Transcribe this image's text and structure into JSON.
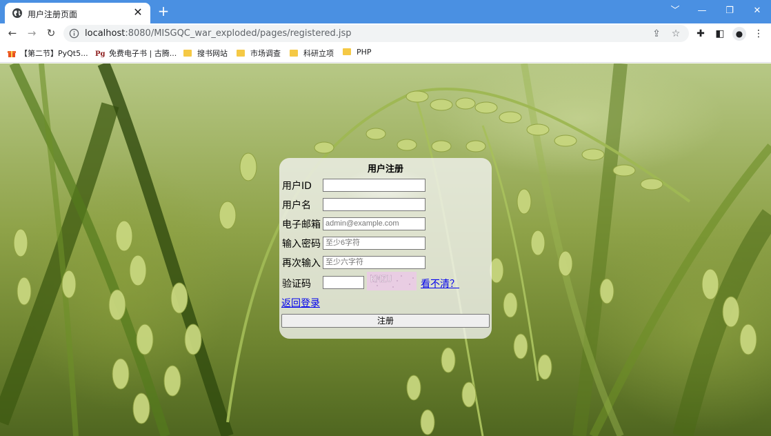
{
  "browser": {
    "tab_title": "用户注册页面",
    "tab_close": "✕",
    "new_tab": "+",
    "url_host": "localhost",
    "url_path": ":8080/MISGQC_war_exploded/pages/registered.jsp",
    "window_controls": [
      "﹀",
      "—",
      "❐",
      "✕"
    ]
  },
  "bookmarks": [
    {
      "label": "【第二节】PyQt5...",
      "icon": "gift-icon"
    },
    {
      "label": "免费电子书 | 古腾...",
      "icon": "pg-icon"
    },
    {
      "label": "搜书网站",
      "icon": "folder-icon"
    },
    {
      "label": "市场调查",
      "icon": "folder-icon"
    },
    {
      "label": "科研立项",
      "icon": "folder-icon"
    },
    {
      "label": "PHP",
      "icon": "folder-icon"
    }
  ],
  "form": {
    "title": "用户注册",
    "user_id_label": "用户ID",
    "username_label": "用户名",
    "email_label": "电子邮箱",
    "email_placeholder": "admin@example.com",
    "password_label": "输入密码",
    "password_placeholder": "至少6字符",
    "confirm_label": "再次输入",
    "confirm_placeholder": "至少六字符",
    "captcha_label": "验证码",
    "captcha_text": "KMZU",
    "refresh_link": "看不清？",
    "back_link": "返回登录",
    "submit_label": "注册"
  }
}
